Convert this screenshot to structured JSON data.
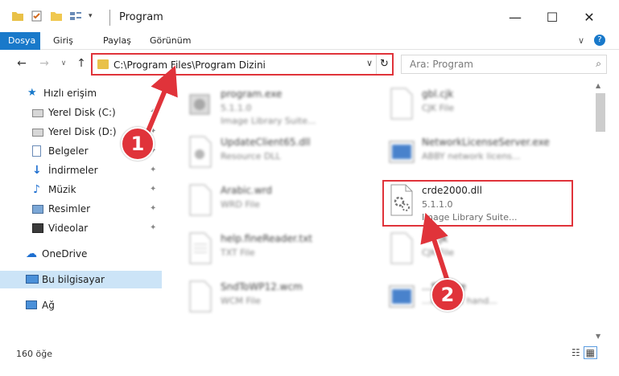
{
  "window": {
    "title": "Program"
  },
  "titlebar": {
    "minimize": "—",
    "maximize": "☐",
    "close": "✕"
  },
  "ribbon": {
    "tabs": [
      "Dosya",
      "Giriş",
      "Paylaş",
      "Görünüm"
    ],
    "collapse": "∨",
    "help": "?"
  },
  "nav": {
    "back": "←",
    "forward": "→",
    "recent": "∨",
    "up": "↑"
  },
  "address": {
    "path": "C:\\Program Files\\Program Dizini",
    "dropdown": "∨",
    "refresh": "↻"
  },
  "search": {
    "placeholder": "Ara: Program",
    "icon": "search-icon"
  },
  "sidebar": {
    "items": [
      {
        "label": "Hızlı erişim",
        "icon": "star-icon"
      },
      {
        "label": "Yerel Disk (C:)",
        "icon": "drive-icon",
        "pin": "📌"
      },
      {
        "label": "Yerel Disk (D:)",
        "icon": "drive-icon",
        "pin": "📌"
      },
      {
        "label": "Belgeler",
        "icon": "documents-icon",
        "pin": "📌"
      },
      {
        "label": "İndirmeler",
        "icon": "download-icon",
        "pin": "📌"
      },
      {
        "label": "Müzik",
        "icon": "music-icon",
        "pin": "📌"
      },
      {
        "label": "Resimler",
        "icon": "pictures-icon",
        "pin": "📌"
      },
      {
        "label": "Videolar",
        "icon": "videos-icon",
        "pin": "📌"
      },
      {
        "label": "OneDrive",
        "icon": "cloud-icon"
      },
      {
        "label": "Bu bilgisayar",
        "icon": "computer-icon"
      },
      {
        "label": "Ağ",
        "icon": "network-icon"
      }
    ]
  },
  "files": {
    "left": [
      {
        "name": "program.exe",
        "line2": "5.1.1.0",
        "line3": "Image Library Suite..."
      },
      {
        "name": "UpdateClient65.dll",
        "line2": "Resource DLL",
        "line3": ""
      },
      {
        "name": "Arabic.wrd",
        "line2": "WRD File",
        "line3": ""
      },
      {
        "name": "help.fineReader.txt",
        "line2": "TXT File",
        "line3": ""
      },
      {
        "name": "SndToWP12.wcm",
        "line2": "WCM File",
        "line3": ""
      }
    ],
    "right": [
      {
        "name": "gbl.cjk",
        "line2": "CJK File",
        "line3": ""
      },
      {
        "name": "NetworkLicenseServer.exe",
        "line2": "ABBY network licens...",
        "line3": ""
      },
      {
        "name": "crde2000.dll",
        "line2": "5.1.1.0",
        "line3": "Image Library Suite..."
      },
      {
        "name": "....cjk",
        "line2": "CJK File",
        "line3": ""
      },
      {
        "name": "...STI.exe",
        "line2": "...a event hand...",
        "line3": ""
      }
    ]
  },
  "status": {
    "count": "160 öğe"
  },
  "callouts": {
    "one": "1",
    "two": "2"
  },
  "colors": {
    "accent": "#1979ca",
    "highlight": "#e0333a",
    "selected": "#cce4f7"
  }
}
